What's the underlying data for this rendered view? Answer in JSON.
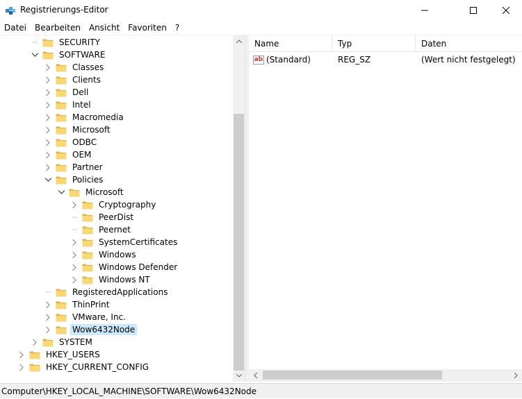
{
  "window": {
    "title": "Registrierungs-Editor"
  },
  "menu": [
    "Datei",
    "Bearbeiten",
    "Ansicht",
    "Favoriten",
    "?"
  ],
  "tree": [
    {
      "label": "SECURITY",
      "level": 2,
      "expander": "none"
    },
    {
      "label": "SOFTWARE",
      "level": 2,
      "expander": "expanded"
    },
    {
      "label": "Classes",
      "level": 3,
      "expander": "collapsed"
    },
    {
      "label": "Clients",
      "level": 3,
      "expander": "collapsed"
    },
    {
      "label": "Dell",
      "level": 3,
      "expander": "collapsed"
    },
    {
      "label": "Intel",
      "level": 3,
      "expander": "collapsed"
    },
    {
      "label": "Macromedia",
      "level": 3,
      "expander": "collapsed"
    },
    {
      "label": "Microsoft",
      "level": 3,
      "expander": "collapsed"
    },
    {
      "label": "ODBC",
      "level": 3,
      "expander": "collapsed"
    },
    {
      "label": "OEM",
      "level": 3,
      "expander": "collapsed"
    },
    {
      "label": "Partner",
      "level": 3,
      "expander": "collapsed"
    },
    {
      "label": "Policies",
      "level": 3,
      "expander": "expanded"
    },
    {
      "label": "Microsoft",
      "level": 4,
      "expander": "expanded"
    },
    {
      "label": "Cryptography",
      "level": 5,
      "expander": "collapsed"
    },
    {
      "label": "PeerDist",
      "level": 5,
      "expander": "none"
    },
    {
      "label": "Peernet",
      "level": 5,
      "expander": "none"
    },
    {
      "label": "SystemCertificates",
      "level": 5,
      "expander": "collapsed"
    },
    {
      "label": "Windows",
      "level": 5,
      "expander": "collapsed"
    },
    {
      "label": "Windows Defender",
      "level": 5,
      "expander": "collapsed"
    },
    {
      "label": "Windows NT",
      "level": 5,
      "expander": "collapsed"
    },
    {
      "label": "RegisteredApplications",
      "level": 3,
      "expander": "none"
    },
    {
      "label": "ThinPrint",
      "level": 3,
      "expander": "collapsed"
    },
    {
      "label": "VMware, Inc.",
      "level": 3,
      "expander": "collapsed"
    },
    {
      "label": "Wow6432Node",
      "level": 3,
      "expander": "collapsed",
      "selected": true
    },
    {
      "label": "SYSTEM",
      "level": 2,
      "expander": "collapsed"
    },
    {
      "label": "HKEY_USERS",
      "level": 1,
      "expander": "collapsed"
    },
    {
      "label": "HKEY_CURRENT_CONFIG",
      "level": 1,
      "expander": "collapsed"
    }
  ],
  "list": {
    "columns": [
      "Name",
      "Typ",
      "Daten"
    ],
    "rows": [
      {
        "name": "(Standard)",
        "type": "REG_SZ",
        "data": "(Wert nicht festgelegt)",
        "icon": "string-value-icon"
      }
    ]
  },
  "statusbar": {
    "path": "Computer\\HKEY_LOCAL_MACHINE\\SOFTWARE\\Wow6432Node"
  },
  "colors": {
    "selection": "#cce8ff",
    "folder": "#f8d775",
    "folder_dark": "#e0b34a"
  }
}
